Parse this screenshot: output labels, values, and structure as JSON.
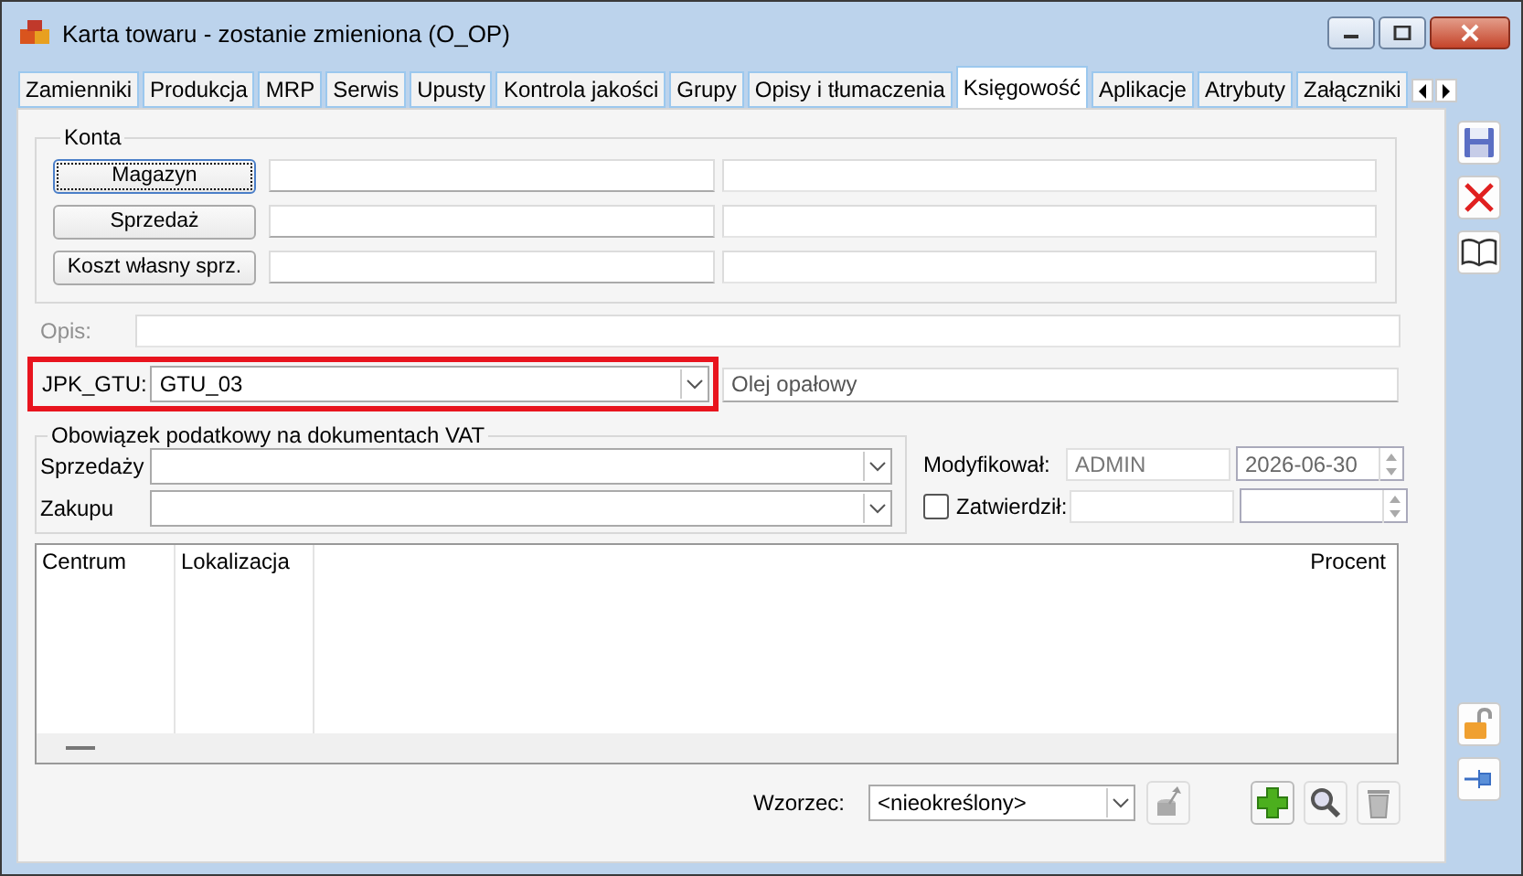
{
  "window": {
    "title": "Karta towaru - zostanie zmieniona (O_OP)"
  },
  "tabs": [
    {
      "label": "Zamienniki",
      "selected": false
    },
    {
      "label": "Produkcja",
      "selected": false
    },
    {
      "label": "MRP",
      "selected": false
    },
    {
      "label": "Serwis",
      "selected": false
    },
    {
      "label": "Upusty",
      "selected": false
    },
    {
      "label": "Kontrola jakości",
      "selected": false
    },
    {
      "label": "Grupy",
      "selected": false
    },
    {
      "label": "Opisy i tłumaczenia",
      "selected": false
    },
    {
      "label": "Księgowość",
      "selected": true
    },
    {
      "label": "Aplikacje",
      "selected": false
    },
    {
      "label": "Atrybuty",
      "selected": false
    },
    {
      "label": "Załączniki",
      "selected": false
    }
  ],
  "konta": {
    "title": "Konta",
    "rows": [
      {
        "label": "Magazyn",
        "focused": true
      },
      {
        "label": "Sprzedaż",
        "focused": false
      },
      {
        "label": "Koszt własny sprz.",
        "focused": false
      }
    ]
  },
  "opis": {
    "label": "Opis:",
    "disabled": true
  },
  "jpk_gtu": {
    "label": "JPK_GTU:",
    "value": "GTU_03",
    "description": "Olej opałowy",
    "highlighted": true
  },
  "vat": {
    "title": "Obowiązek podatkowy na dokumentach VAT",
    "rows": [
      {
        "label": "Sprzedaży"
      },
      {
        "label": "Zakupu"
      }
    ]
  },
  "modyfikowal": {
    "label": "Modyfikował:",
    "user": "ADMIN",
    "date": "2026-06-30"
  },
  "zatwierdzil": {
    "label": "Zatwierdził:",
    "checked": false
  },
  "table": {
    "columns": [
      "Centrum",
      "Lokalizacja",
      "Procent"
    ]
  },
  "wzorzec": {
    "label": "Wzorzec:",
    "value": "<nieokreślony>"
  }
}
